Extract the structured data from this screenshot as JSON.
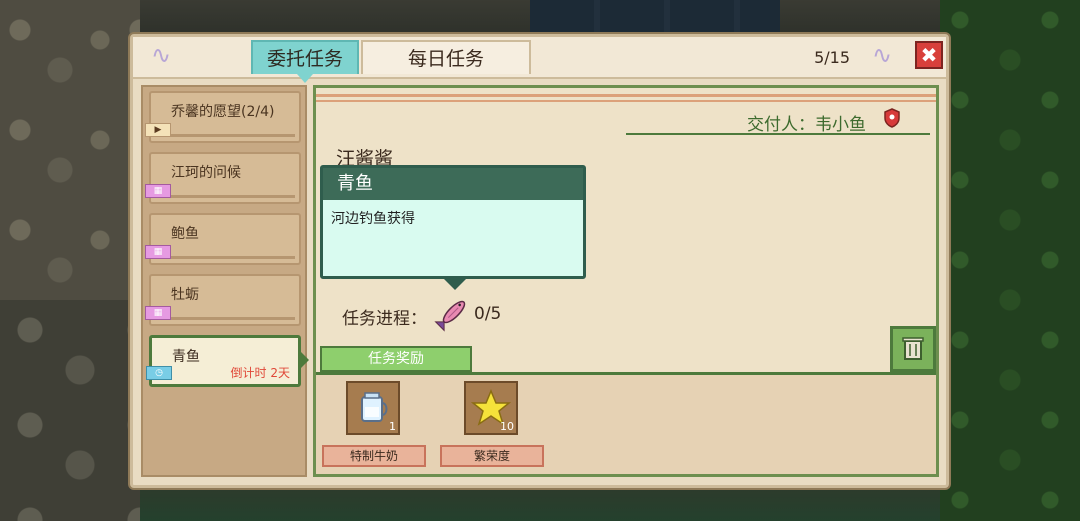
{
  "header": {
    "tabs": [
      {
        "label": "委托任务",
        "active": true
      },
      {
        "label": "每日任务",
        "active": false
      }
    ],
    "counter": "5/15",
    "close_label": "✖"
  },
  "sidebar": {
    "items": [
      {
        "label": "乔馨的愿望(2/4)",
        "tag_icon": "flag-icon"
      },
      {
        "label": "江珂的问候",
        "tag_icon": "calendar-icon"
      },
      {
        "label": "鲍鱼",
        "tag_icon": "calendar-icon"
      },
      {
        "label": "牡蛎",
        "tag_icon": "calendar-icon"
      },
      {
        "label": "青鱼",
        "tag_icon": "clock-icon",
        "timer": "倒计时 2天",
        "selected": true
      }
    ]
  },
  "detail": {
    "deliverer": "交付人：韦小鱼",
    "title": "汪酱酱",
    "tooltip": {
      "title": "青鱼",
      "description": "河边钓鱼获得"
    },
    "progress_label": "任务进程：",
    "progress_value": "0/5",
    "reward_tab": "任务奖励",
    "rewards": [
      {
        "name": "特制牛奶",
        "qty": "1",
        "icon": "milk-jug-icon"
      },
      {
        "name": "繁荣度",
        "qty": "10",
        "icon": "star-icon"
      }
    ]
  },
  "colors": {
    "accent_tab": "#7fd3cf",
    "frame_green": "#4d7a3c",
    "close_red": "#d8403b",
    "timer_red": "#e04838"
  }
}
